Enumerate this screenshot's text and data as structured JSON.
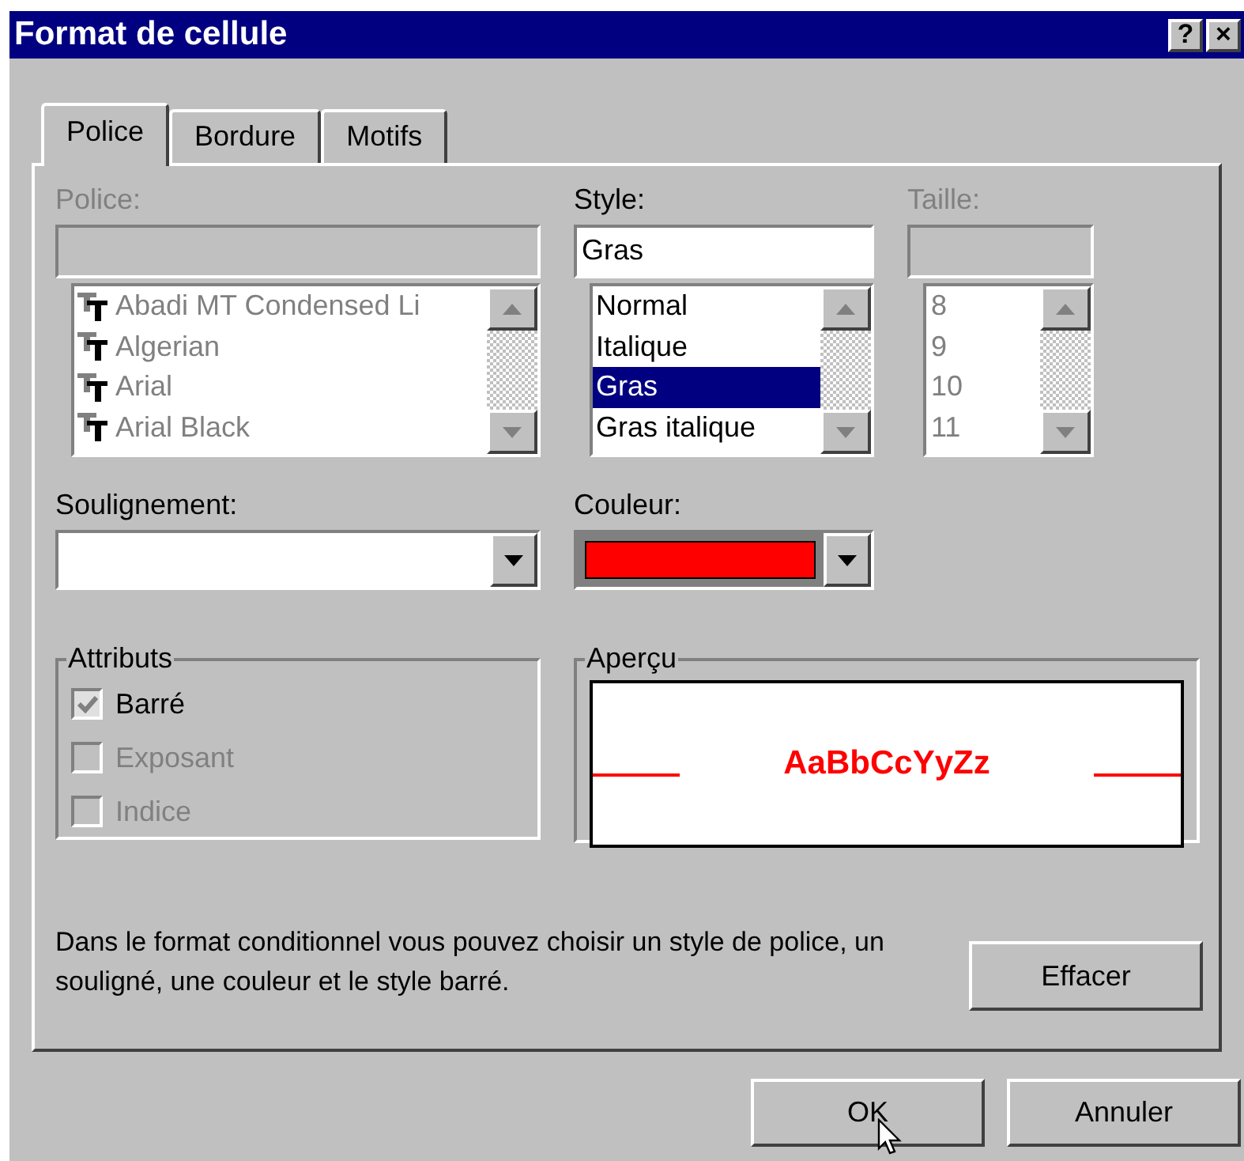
{
  "window": {
    "title": "Format de cellule",
    "buttons": [
      "?",
      "×"
    ]
  },
  "tabs": [
    {
      "label": "Police",
      "selected": true
    },
    {
      "label": "Bordure",
      "selected": false
    },
    {
      "label": "Motifs",
      "selected": false
    }
  ],
  "font": {
    "label": "Police:",
    "disabled": true,
    "items": [
      "Abadi MT Condensed Li",
      "Algerian",
      "Arial",
      "Arial Black"
    ]
  },
  "style": {
    "label": "Style:",
    "value": "Gras",
    "items": [
      {
        "label": "Normal",
        "selected": false
      },
      {
        "label": "Italique",
        "selected": false
      },
      {
        "label": "Gras",
        "selected": true
      },
      {
        "label": "Gras italique",
        "selected": false
      }
    ]
  },
  "size": {
    "label": "Taille:",
    "disabled": true,
    "items": [
      "8",
      "9",
      "10",
      "11"
    ]
  },
  "underline": {
    "label": "Soulignement:"
  },
  "color": {
    "label": "Couleur:",
    "color": "#ff0000"
  },
  "attributes": {
    "title": "Attributs",
    "items": [
      {
        "label": "Barré",
        "checked": true,
        "disabled": false
      },
      {
        "label": "Exposant",
        "checked": false,
        "disabled": true
      },
      {
        "label": "Indice",
        "checked": false,
        "disabled": true
      }
    ]
  },
  "preview": {
    "title": "Aperçu",
    "sample": "AaBbCcYyZz",
    "color": "#ff0000",
    "strikethrough": true
  },
  "note": "Dans le format conditionnel vous pouvez choisir un style de police, un souligné, une couleur et le style barré.",
  "clear_button": "Effacer",
  "buttons": [
    "OK",
    "Annuler"
  ]
}
